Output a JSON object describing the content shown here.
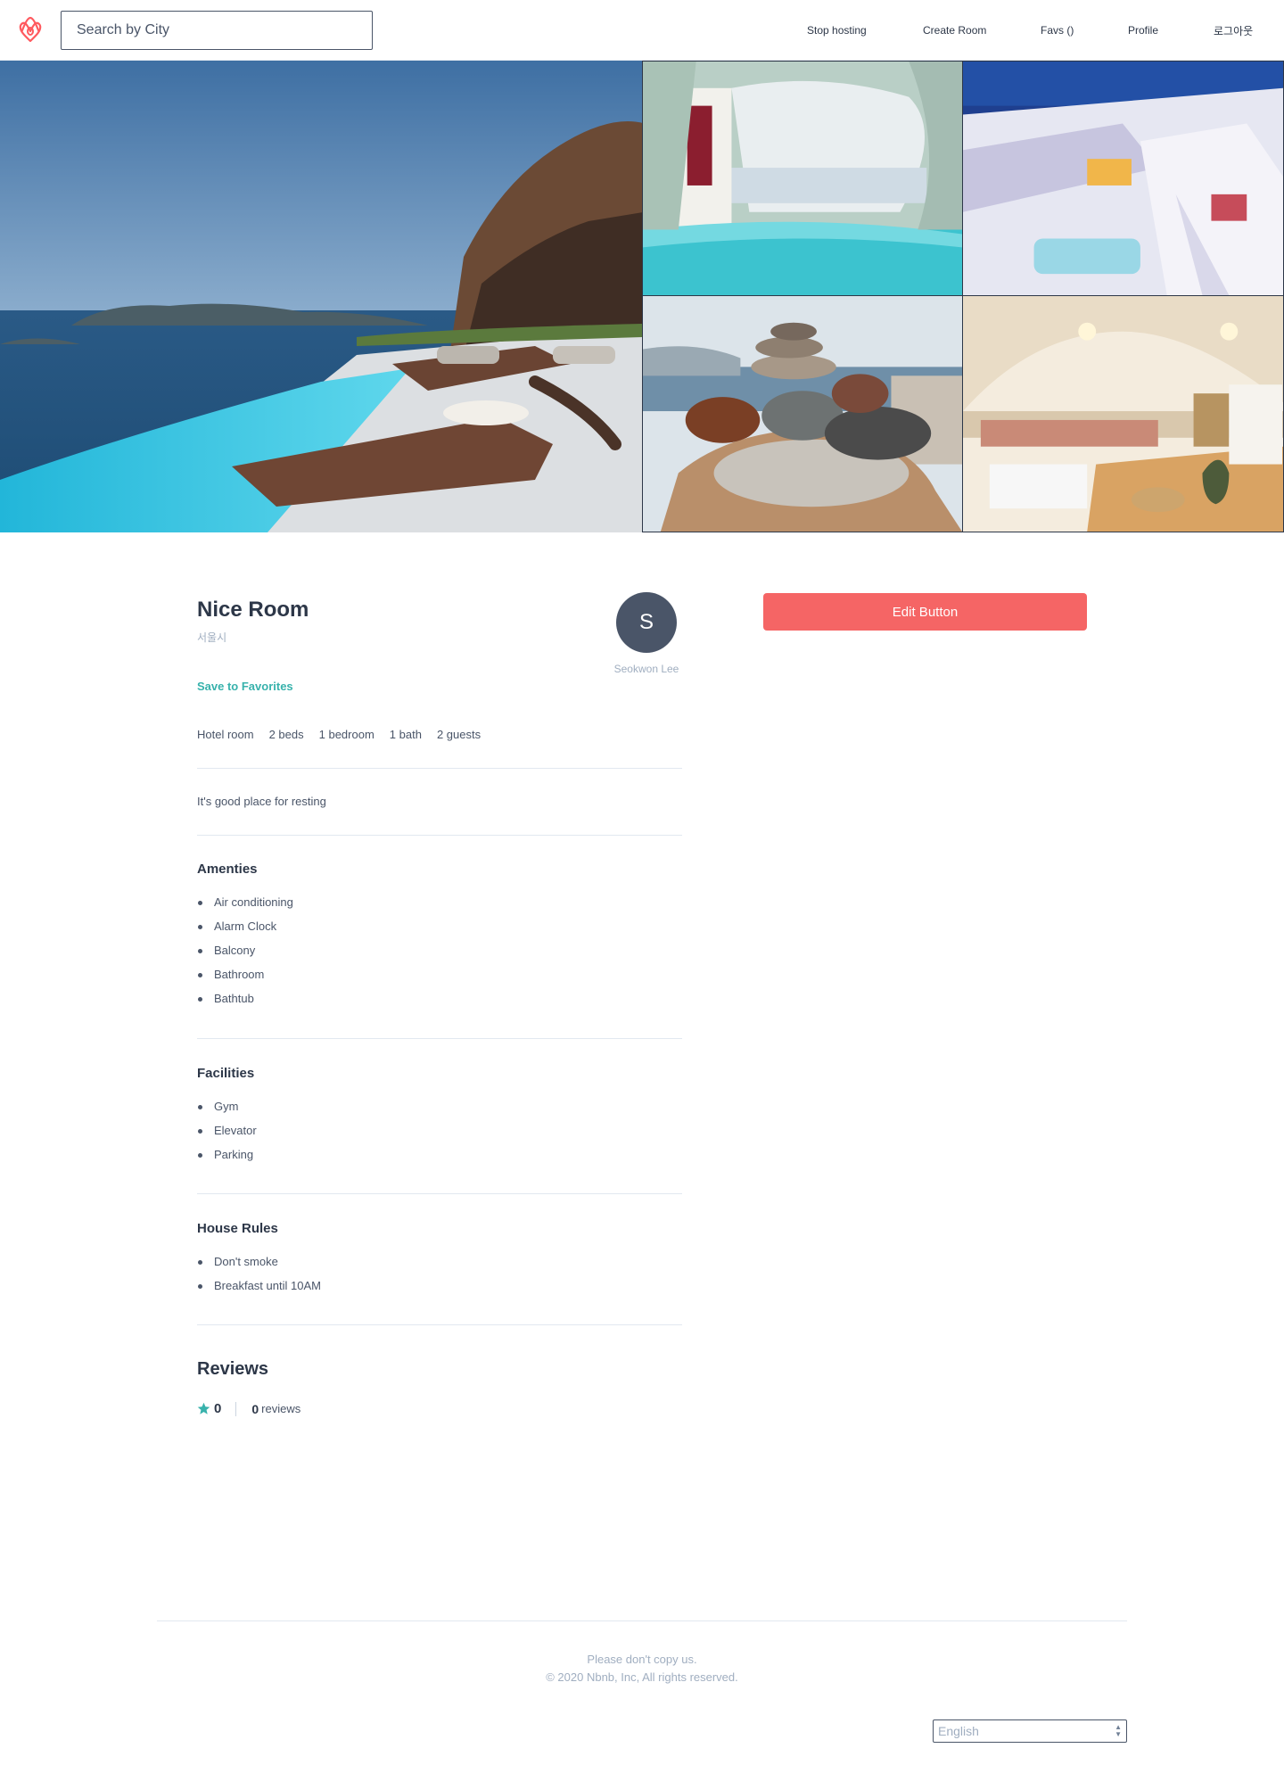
{
  "header": {
    "search_placeholder": "Search by City",
    "nav": {
      "stop_hosting": "Stop hosting",
      "create_room": "Create Room",
      "favs": "Favs ()",
      "profile": "Profile",
      "logout": "로그아웃"
    }
  },
  "room": {
    "name": "Nice Room",
    "city": "서울시",
    "save_label": "Save to Favorites",
    "details": [
      "Hotel room",
      "2 beds",
      "1 bedroom",
      "1 bath",
      "2 guests"
    ],
    "description": "It's good place for resting",
    "host": {
      "initial": "S",
      "name": "Seokwon Lee"
    }
  },
  "amenities": {
    "title": "Amenties",
    "items": [
      "Air conditioning",
      "Alarm Clock",
      "Balcony",
      "Bathroom",
      "Bathtub"
    ]
  },
  "facilities": {
    "title": "Facilities",
    "items": [
      "Gym",
      "Elevator",
      "Parking"
    ]
  },
  "house_rules": {
    "title": "House Rules",
    "items": [
      "Don't smoke",
      "Breakfast until 10AM"
    ]
  },
  "reviews": {
    "title": "Reviews",
    "rating": "0",
    "count": "0",
    "count_label": "reviews"
  },
  "edit_button": "Edit Button",
  "footer": {
    "line1": "Please don't copy us.",
    "line2": "© 2020 Nbnb, Inc, All rights reserved.",
    "language": "English"
  },
  "colors": {
    "brand": "#ff5a5f",
    "accent": "#38b2ac",
    "button": "#f56565",
    "text": "#4a5568"
  }
}
